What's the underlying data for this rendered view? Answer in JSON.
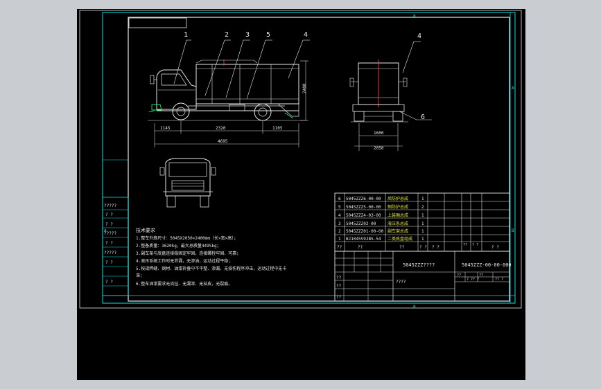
{
  "sheet": {
    "grid_col_top": "8",
    "grid_col_bottom": "8",
    "grid_row_a": "A",
    "grid_row_b": "B",
    "grid_row_a2": "A"
  },
  "callouts": {
    "c1": "1",
    "c2": "2",
    "c3": "3",
    "c5": "5",
    "c4": "4",
    "rear4": "4",
    "rear6": "6"
  },
  "dims": {
    "d1": "1145",
    "d2": "2320",
    "d3": "1105",
    "total": "4695",
    "height": "2400",
    "track": "1600",
    "width": "2050"
  },
  "left_strip": [
    "?????",
    "? ?",
    "? ?",
    "?????",
    "? ?",
    "?????",
    "? ?",
    "? ?"
  ],
  "tech": {
    "heading": "技术要求",
    "lines": [
      "1.整车外廓尺寸：5045X2050×2400mm（长×宽×高）；",
      "2.整备质量：3620kg，最大总质量4495kg；",
      "3.副车架与底盘连接稳固定牢固，连接螺栓牢固、可靠；",
      "4.液压系统工作时无泄漏，无渗油，运动过程平稳；",
      "5.按规焊缝、钢材、油漆折叠中不平整、渗漏、无损伤程序冲击，运动过程中无卡",
      "  滞；",
      "6.整车油漆要求无流挂、无漏漆、无桔皮，无裂痕。"
    ]
  },
  "bom": [
    {
      "no": "6",
      "code": "5045ZZZ6-00-00",
      "name": "后防护总成",
      "qty": "1"
    },
    {
      "no": "5",
      "code": "5045ZZZ5-00-00",
      "name": "侧防护总成",
      "qty": "2"
    },
    {
      "no": "4",
      "code": "5045ZZZ4-03-00",
      "name": "上装厢总成",
      "qty": "1"
    },
    {
      "no": "3",
      "code": "5045ZZZ02-00",
      "name": "液压系总成",
      "qty": "1"
    },
    {
      "no": "2",
      "code": "5045ZZZ01-00-00",
      "name": "副车架总成",
      "qty": "1"
    },
    {
      "no": "1",
      "code": "BJ1045V9JB5-54",
      "name": "二类底盘组成",
      "qty": "1"
    }
  ],
  "bom_header": [
    "??",
    "??",
    "??",
    "? ?",
    "? ?",
    "??",
    "? ?",
    "? ?"
  ],
  "title_block": {
    "name": "5045ZZZ????",
    "drawing_no": "5045ZZZ-00-00-000",
    "cell_a": "????",
    "cell_b": "??",
    "cell_c": "??",
    "cell_d": "??",
    "cell_e": "??",
    "cell_f": "? ?? ?",
    "cell_g": "??",
    "cell_h": "?? ?"
  }
}
